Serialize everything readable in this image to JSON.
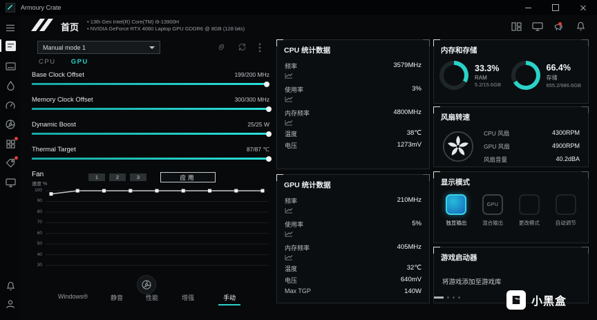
{
  "colors": {
    "accent": "#2ad2c9",
    "alert": "#e23c3c"
  },
  "titlebar": {
    "app_name": "Armoury Crate"
  },
  "header": {
    "page_title": "首页",
    "device_lines": [
      "13th Gen Intel(R) Core(TM) i9-13900H",
      "NVIDIA GeForce RTX 4060 Laptop GPU GDDR6 @ 8GB (128 bits)"
    ]
  },
  "tuning": {
    "mode_dropdown": "Manual mode 1",
    "tabs": {
      "cpu": "CPU",
      "gpu": "GPU"
    },
    "sliders": [
      {
        "label": "Base Clock Offset",
        "value": "199/200 MHz",
        "pct": 99
      },
      {
        "label": "Memory Clock Offset",
        "value": "300/300 MHz",
        "pct": 100
      },
      {
        "label": "Dynamic Boost",
        "value": "25/25 W",
        "pct": 100
      },
      {
        "label": "Thermal Target",
        "value": "87/87 ℃",
        "pct": 100
      }
    ],
    "fan": {
      "label": "Fan",
      "axis_label": "速度 %",
      "presets": [
        "1",
        "2",
        "3"
      ],
      "apply_label": "应用"
    },
    "chart_data": {
      "type": "line",
      "ylabel": "速度 %",
      "yticks": [
        100,
        90,
        80,
        70,
        60,
        50,
        40,
        30
      ],
      "values": [
        97,
        100,
        100,
        100,
        100,
        100,
        100,
        100,
        100
      ],
      "ymin": 30,
      "ymax": 100
    },
    "bottom_tabs": [
      {
        "label": "Windows®"
      },
      {
        "label": "静音"
      },
      {
        "label": "性能"
      },
      {
        "label": "增强"
      },
      {
        "label": "手动"
      }
    ]
  },
  "cpu_panel": {
    "title": "CPU 统计数据",
    "rows": [
      {
        "label": "频率",
        "value": "3579MHz"
      },
      {
        "label": "使用率",
        "value": "3%"
      },
      {
        "label": "内存频率",
        "value": "4800MHz"
      },
      {
        "label": "温度",
        "value": "38℃"
      },
      {
        "label": "电压",
        "value": "1273mV"
      }
    ]
  },
  "gpu_panel": {
    "title": "GPU 统计数据",
    "rows": [
      {
        "label": "频率",
        "value": "210MHz"
      },
      {
        "label": "使用率",
        "value": "5%"
      },
      {
        "label": "内存频率",
        "value": "405MHz"
      },
      {
        "label": "温度",
        "value": "32℃"
      },
      {
        "label": "电压",
        "value": "640mV"
      },
      {
        "label": "Max TGP",
        "value": "140W"
      }
    ]
  },
  "memory_panel": {
    "title": "内存和存储",
    "gauges": [
      {
        "percent": "33.3%",
        "value": 33.3,
        "label": "RAM",
        "detail": "5.2/15.6GB"
      },
      {
        "percent": "66.4%",
        "value": 66.4,
        "label": "存储",
        "detail": "655.2/986.6GB"
      }
    ]
  },
  "fan_panel": {
    "title": "风扇转速",
    "rows": [
      {
        "label": "CPU 风扇",
        "value": "4300RPM"
      },
      {
        "label": "GPU 风扇",
        "value": "4900RPM"
      },
      {
        "label": "风扇音量",
        "value": "40.2dBA"
      }
    ]
  },
  "display_panel": {
    "title": "显示模式",
    "options": [
      {
        "label": "独显输出",
        "icon": "gpu-chip-active"
      },
      {
        "label": "混合输出",
        "icon": "gpu-chip",
        "chip_text": "GPU"
      },
      {
        "label": "更改模式",
        "icon": "gpu-chip-dim"
      },
      {
        "label": "自动调节",
        "icon": "gpu-chip-dim"
      }
    ]
  },
  "game_panel": {
    "title": "游戏启动器",
    "empty_text": "将游戏添加至游戏库"
  },
  "watermark": {
    "text": "小黑盒"
  }
}
